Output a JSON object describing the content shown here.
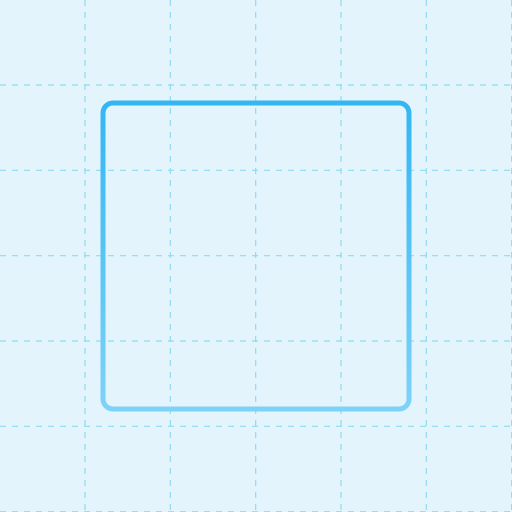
{
  "canvas": {
    "background": "#e3f4fc"
  },
  "grid": {
    "visible": true,
    "style": "dashed",
    "color": "#8fdcec",
    "columns": 6,
    "rows": 6
  },
  "shape": {
    "type": "rounded-square-outline",
    "fill": "none",
    "stroke_gradient": [
      "#33b6f2",
      "#7ed2f8"
    ],
    "gradient_direction": "top-to-bottom"
  }
}
